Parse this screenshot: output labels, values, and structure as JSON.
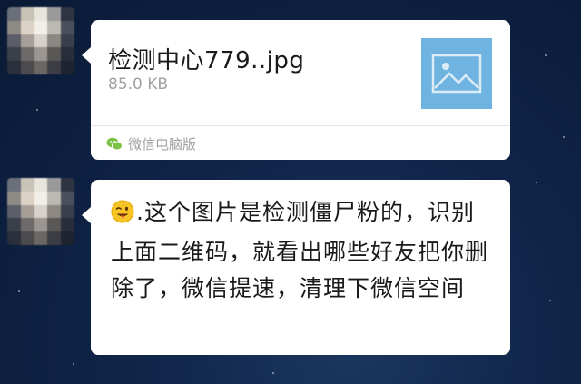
{
  "messages": [
    {
      "type": "file",
      "file_name": "检测中心779..jpg",
      "file_size": "85.0 KB",
      "source_icon": "wechat-icon",
      "source_label": "微信电脑版",
      "thumbnail_icon": "image-icon"
    },
    {
      "type": "text",
      "emoji": "winking-tongue-face",
      "text": ".这个图片是检测僵尸粉的，识别上面二维码，就看出哪些好友把你删除了，微信提速，清理下微信空间"
    }
  ],
  "colors": {
    "background": "#0f2447",
    "bubble": "#ffffff",
    "thumbnail": "#6fb3e0",
    "wechat_green": "#7bc144"
  }
}
